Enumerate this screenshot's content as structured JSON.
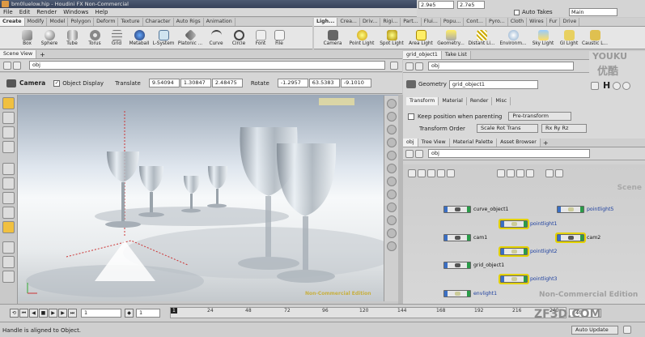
{
  "window": {
    "title": "bm0luelow.hip - Houdini FX Non-Commercial"
  },
  "menu": [
    "File",
    "Edit",
    "Render",
    "Windows",
    "Help"
  ],
  "top_status": {
    "field1": "2.9e5",
    "field2": "2.7e5",
    "auto_takes_label": "Auto Takes",
    "take_value": "Main"
  },
  "shelf_left": {
    "tabs": [
      "Create",
      "Modify",
      "Model",
      "Polygon",
      "Deform",
      "Texture",
      "Character",
      "Auto Rigs",
      "Animation"
    ],
    "active_tab": "Create",
    "tools": [
      "Box",
      "Sphere",
      "Tube",
      "Torus",
      "Grid",
      "Metaball",
      "L-System",
      "Platonic ...",
      "Curve",
      "Circle",
      "Font",
      "File"
    ]
  },
  "shelf_right": {
    "tabs": [
      "Ligh...",
      "Crea...",
      "Driv...",
      "Rigi...",
      "Part...",
      "Flui...",
      "Popu...",
      "Cont...",
      "Pyro...",
      "Cloth",
      "Wires",
      "Fur",
      "Drive"
    ],
    "active_tab": "Ligh...",
    "tools": [
      "Camera",
      "Point Light",
      "Spot Light",
      "Area Light",
      "Geometry...",
      "Distant Li...",
      "Environm...",
      "Sky Light",
      "GI Light",
      "Caustic L..."
    ]
  },
  "scene_view": {
    "tab_label": "Scene View",
    "path": "obj",
    "camera_label": "Camera",
    "object_display_label": "Object Display",
    "translate_label": "Translate",
    "translate": [
      "9.54094",
      "1.30847",
      "2.48475"
    ],
    "rotate_label": "Rotate",
    "rotate": [
      "-1.2957",
      "63.5383",
      "-9.1010"
    ],
    "watermark": "Non-Commercial Edition"
  },
  "param_pane": {
    "tabs": [
      "grid_object1",
      "Take List"
    ],
    "path": "obj",
    "node_type": "Geometry",
    "node_name": "grid_object1",
    "sub_tabs": [
      "Transform",
      "Material",
      "Render",
      "Misc"
    ],
    "keep_position_label": "Keep position when parenting",
    "keep_position_value": "Pre-transform",
    "transform_order_label": "Transform Order",
    "transform_order_value": "Scale Rot Trans",
    "rot_order_value": "Rx Ry Rz"
  },
  "network_pane": {
    "tabs": [
      "obj",
      "Tree View",
      "Material Palette",
      "Asset Browser"
    ],
    "path": "obj",
    "scene_label": "Scene",
    "watermark": "Non-Commercial Edition",
    "nodes": [
      {
        "name": "curve_object1",
        "selected": false,
        "light": false
      },
      {
        "name": "pointlight5",
        "selected": false,
        "light": true
      },
      {
        "name": "pointlight1",
        "selected": true,
        "light": true
      },
      {
        "name": "cam1",
        "selected": false,
        "light": false
      },
      {
        "name": "cam2",
        "selected": true,
        "light": false
      },
      {
        "name": "pointlight2",
        "selected": true,
        "light": true
      },
      {
        "name": "grid_object1",
        "selected": false,
        "light": false
      },
      {
        "name": "pointlight3",
        "selected": true,
        "light": true
      },
      {
        "name": "envlight1",
        "selected": false,
        "light": true
      }
    ]
  },
  "timeline": {
    "start_frame": "1",
    "current_frame": "1",
    "end_frame": "240",
    "ticks": [
      "1",
      "24",
      "48",
      "72",
      "96",
      "120",
      "144",
      "168",
      "192",
      "216",
      "240"
    ]
  },
  "status": {
    "message": "Handle is aligned to Object.",
    "auto_update": "Auto Update"
  },
  "branding": {
    "logo_text": "优酷",
    "site_text": "ZF3D.COM",
    "youku": "YOUKU"
  }
}
